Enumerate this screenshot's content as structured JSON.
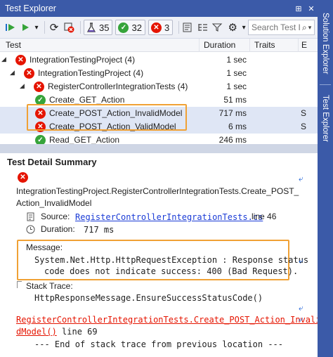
{
  "window": {
    "title": "Test Explorer",
    "pin": "⊞",
    "close": "✕"
  },
  "toolbar": {
    "run_all": "▶",
    "run": "▶",
    "dropdown": "▾",
    "refresh": "⟳",
    "cancel": "✕",
    "flask_count": "35",
    "passed_count": "32",
    "failed_count": "3",
    "settings_dd": "▾"
  },
  "search": {
    "placeholder": "Search Test I"
  },
  "columns": {
    "test": "Test",
    "duration": "Duration",
    "traits": "Traits",
    "e": "E"
  },
  "tree": [
    {
      "label": "IntegrationTestingProject (4)",
      "duration": "1 sec",
      "tail": "",
      "status": "failed",
      "arrow": "◢"
    },
    {
      "label": "IntegrationTestingProject (4)",
      "duration": "1 sec",
      "tail": "",
      "status": "failed",
      "arrow": "◢"
    },
    {
      "label": "RegisterControllerIntegrationTests (4)",
      "duration": "1 sec",
      "tail": "",
      "status": "failed",
      "arrow": "◢"
    },
    {
      "label": "Create_GET_Action",
      "duration": "51 ms",
      "tail": "",
      "status": "passed",
      "arrow": ""
    },
    {
      "label": "Create_POST_Action_InvalidModel",
      "duration": "717 ms",
      "tail": "S",
      "status": "failed",
      "arrow": ""
    },
    {
      "label": "Create_POST_Action_ValidModel",
      "duration": "6 ms",
      "tail": "S",
      "status": "failed",
      "arrow": ""
    },
    {
      "label": "Read_GET_Action",
      "duration": "246 ms",
      "tail": "",
      "status": "passed",
      "arrow": ""
    }
  ],
  "detail": {
    "title": "Test Detail Summary",
    "test_line1": "IntegrationTestingProject.RegisterControllerIntegrationTests.Create_POST_",
    "test_line2": "Action_InvalidModel",
    "source_label": "Source:",
    "source_link": "RegisterControllerIntegrationTests.cs",
    "source_line": "line 46",
    "duration_label": "Duration:",
    "duration_value": "717 ms",
    "message_label": "Message:",
    "message_line1": "System.Net.Http.HttpRequestException : Response status",
    "message_line2": "code does not indicate success: 400 (Bad Request).",
    "stack_label": "Stack Trace:",
    "stack_line1": "HttpResponseMessage.EnsureSuccessStatusCode()",
    "stack_link1": "RegisterControllerIntegrationTests.Create_POST_Action_Invali",
    "stack_link2": "dModel()",
    "stack_line2_tail": " line 69",
    "stack_end": "--- End of stack trace from previous location ---"
  },
  "sidebar": {
    "tab1": "Solution Explorer",
    "tab2": "Test Explorer"
  },
  "colors": {
    "accent": "#3b5aa8",
    "failed": "#e51400",
    "passed": "#36a43a",
    "highlight": "#f0a135"
  }
}
